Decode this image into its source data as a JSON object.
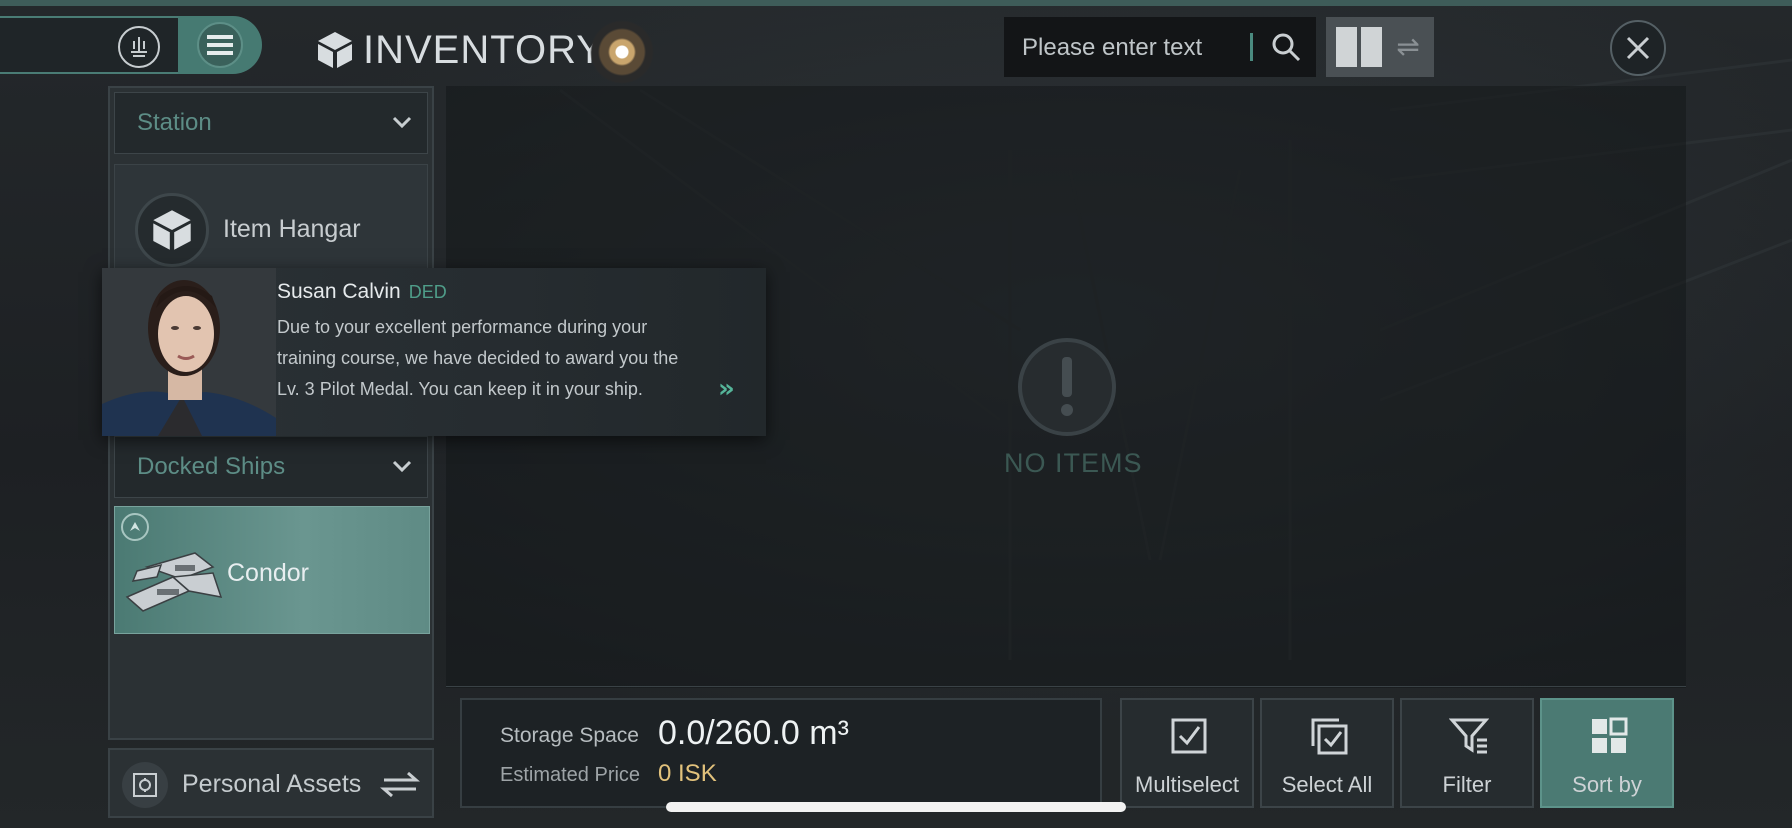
{
  "header": {
    "title": "INVENTORY",
    "search": {
      "placeholder": "Please enter text"
    }
  },
  "sidebar": {
    "station_section": {
      "label": "Station"
    },
    "item_hangar": {
      "label": "Item Hangar"
    },
    "docked_ships_section": {
      "label": "Docked Ships"
    },
    "ships": [
      {
        "label": "Condor"
      }
    ],
    "personal_assets": {
      "label": "Personal Assets"
    }
  },
  "notification": {
    "sender": "Susan Calvin",
    "tag": "DED",
    "lines": [
      "Due to your excellent performance during your",
      "training course, we have decided to award you the",
      "Lv. 3 Pilot Medal. You can keep it in your ship."
    ]
  },
  "main": {
    "empty_label": "NO ITEMS"
  },
  "footer": {
    "storage_label": "Storage Space",
    "storage_value": "0.0/260.0 m³",
    "price_label": "Estimated Price",
    "price_value": "0 ISK",
    "actions": [
      {
        "label": "Multiselect"
      },
      {
        "label": "Select All"
      },
      {
        "label": "Filter"
      },
      {
        "label": "Sort by"
      }
    ]
  },
  "colors": {
    "accent": "#4b7a73",
    "accent_text": "#5d8d86",
    "price": "#e2c27c",
    "tag": "#4f9d89"
  },
  "icons": [
    "corp-icon",
    "menu-icon",
    "cube-icon",
    "compass-orb-icon",
    "search-icon",
    "split-view-icon",
    "swap-icon",
    "close-icon",
    "chevron-down-icon",
    "item-hangar-icon",
    "ship-up-icon",
    "safe-icon",
    "exclamation-icon",
    "checkbox-icon",
    "double-checkbox-icon",
    "filter-icon",
    "grid-icon"
  ]
}
